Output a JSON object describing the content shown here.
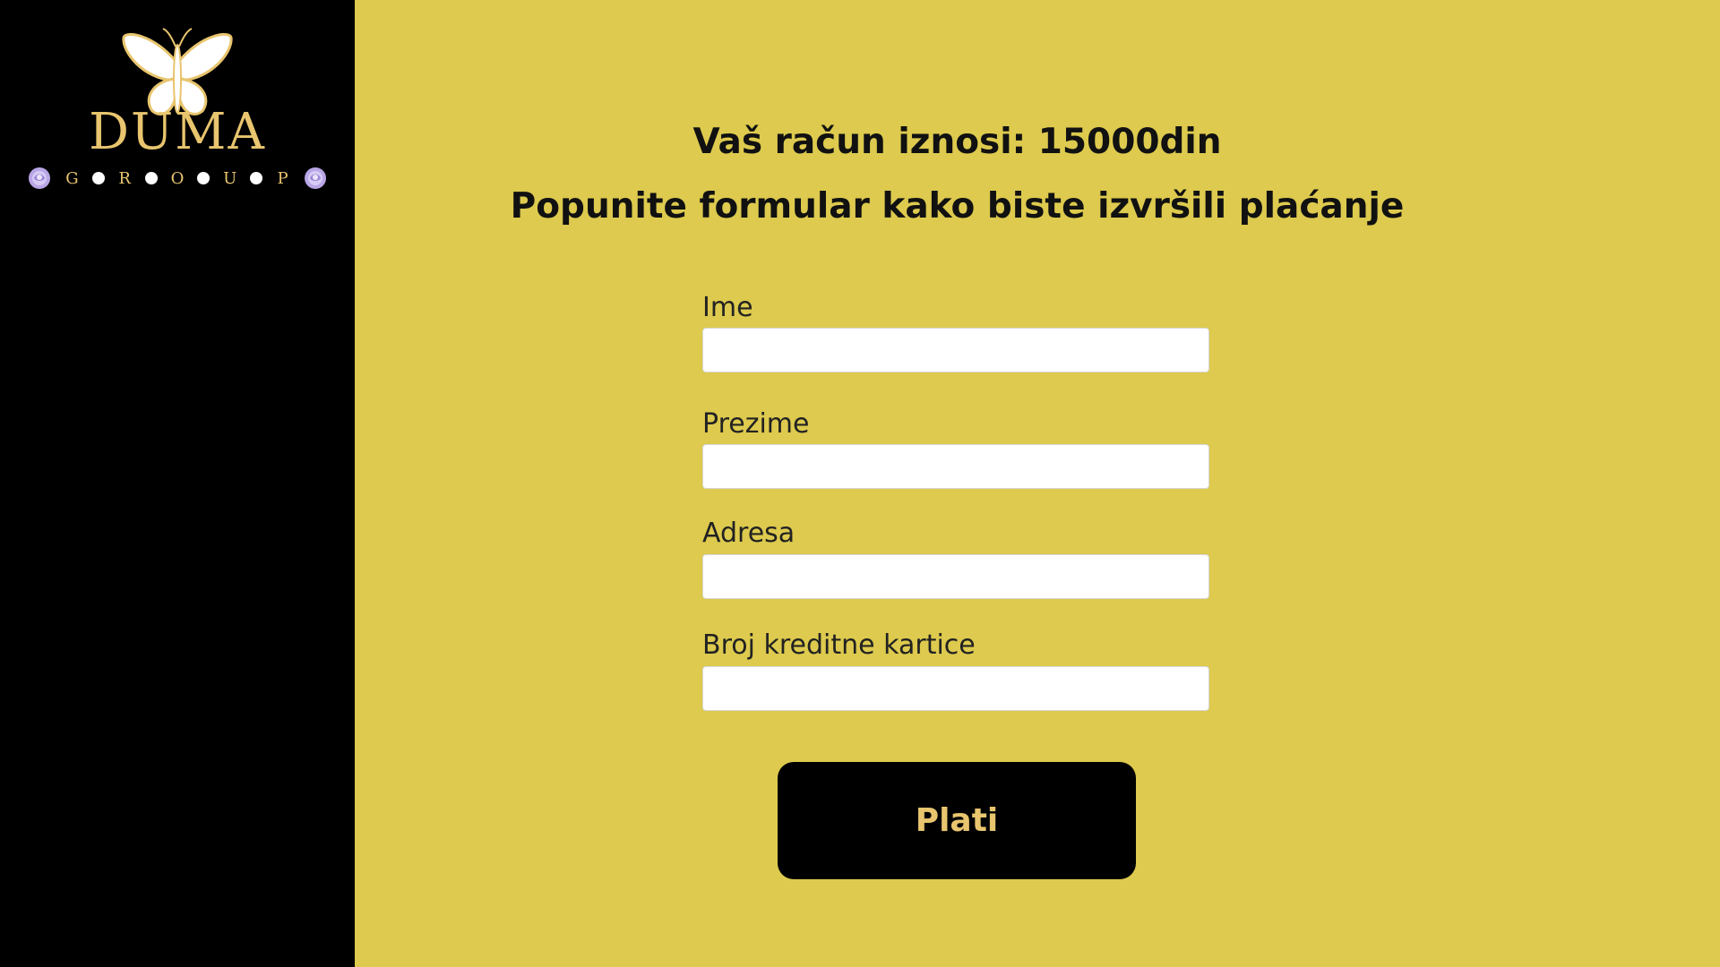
{
  "brand": {
    "name": "DUMA",
    "sub_letters": [
      "G",
      "R",
      "O",
      "U",
      "P"
    ],
    "logo_icon": "butterfly-icon",
    "accent_color": "#e8c56e"
  },
  "page": {
    "background": "#ddca4e",
    "sidebar_background": "#000000"
  },
  "header": {
    "amount_text": "Vaš račun iznosi: 15000din",
    "instruction_text": "Popunite formular kako biste izvršili plaćanje"
  },
  "form": {
    "fields": [
      {
        "label": "Ime",
        "value": "",
        "placeholder": ""
      },
      {
        "label": "Prezime",
        "value": "",
        "placeholder": ""
      },
      {
        "label": "Adresa",
        "value": "",
        "placeholder": ""
      },
      {
        "label": "Broj kreditne kartice",
        "value": "",
        "placeholder": ""
      }
    ],
    "submit_label": "Plati"
  }
}
